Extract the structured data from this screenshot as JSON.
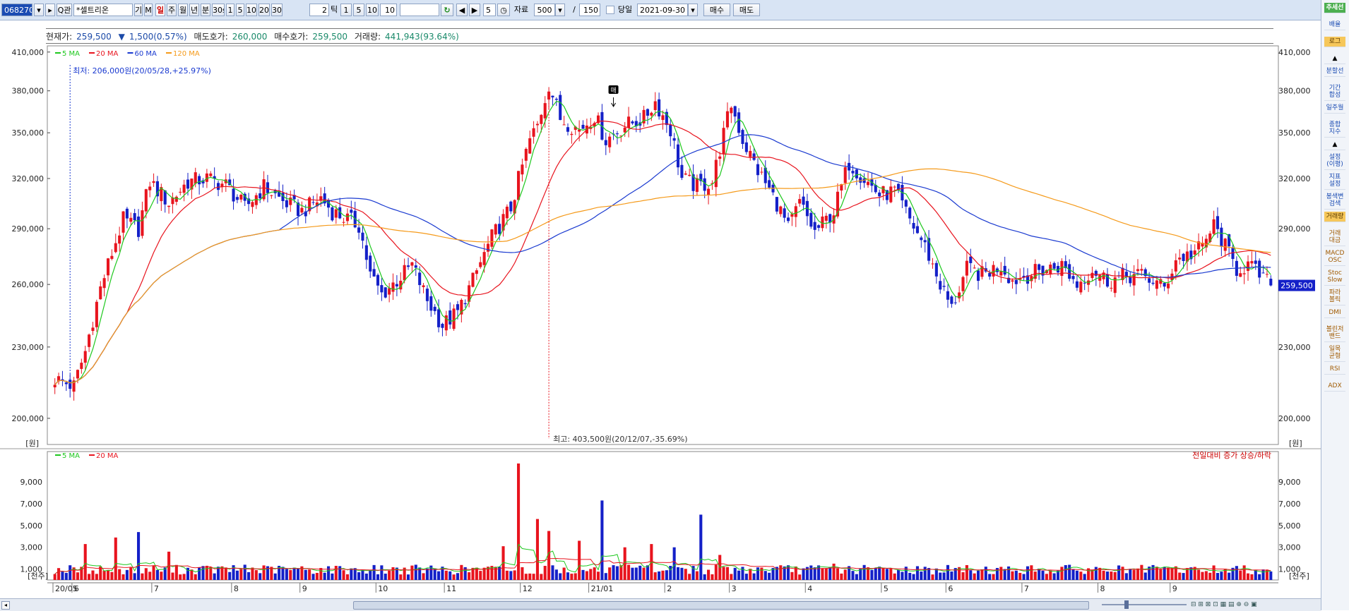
{
  "toolbar": {
    "code": "068270",
    "search_label": "Q",
    "search_badge": "관",
    "stock_name": "*셀트리온",
    "btn_gi": "기",
    "btn_m": "M",
    "periods": [
      "일",
      "주",
      "월",
      "년",
      "분",
      "30s",
      "1",
      "5",
      "10",
      "20",
      "30"
    ],
    "tick_value": "2",
    "tick_label": "틱",
    "tick_opts": [
      "1",
      "5",
      "10"
    ],
    "tick_count": "10",
    "step_value": "5",
    "data_label": "자료",
    "data_count": "500",
    "slash": "/",
    "view_count": "150",
    "today_label": "당일",
    "date": "2021-09-30",
    "buy_label": "매수",
    "sell_label": "매도"
  },
  "info": {
    "price_label": "현재가:",
    "price": "259,500",
    "change_arrow": "▼",
    "change": "1,500(0.57%)",
    "ask_label": "매도호가:",
    "ask": "260,000",
    "bid_label": "매수호가:",
    "bid": "259,500",
    "vol_label": "거래량:",
    "vol": "441,943(93.64%)"
  },
  "sidebar": {
    "items": [
      "추세선",
      "배율",
      "로그",
      "▲",
      "분할선",
      "기간\n합성",
      "일주월",
      "종합\n지수",
      "▲",
      "설정\n(이평)",
      "지표\n설정",
      "봉색변\n검색",
      "거래량",
      "거래\n대금",
      "MACD\nOSC",
      "Stoc\nSlow",
      "파라\n볼릭",
      "DMI",
      "볼린저\n밴드",
      "일목\n균형",
      "RSI",
      "ADX"
    ]
  },
  "colors": {
    "up": "#e8141e",
    "down": "#1420c8",
    "ma5": "#1ec81e",
    "ma20": "#e8141e",
    "ma60": "#1a3ad0",
    "ma120": "#f59a1a",
    "axis": "#444444",
    "grid": "#cccccc",
    "lowline": "#1a3ad0",
    "highline": "#e8141e",
    "label": "#1a3ad0"
  },
  "chart_data": [
    {
      "type": "candlestick",
      "title": "",
      "legend": [
        "5 MA",
        "20 MA",
        "60 MA",
        "120 MA"
      ],
      "unit": "[원]",
      "y_ticks": [
        "410,000",
        "380,000",
        "350,000",
        "320,000",
        "290,000",
        "260,000",
        "230,000",
        "200,000"
      ],
      "ylim": [
        190000,
        415000
      ],
      "log_scale": true,
      "x_labels": [
        "20/05",
        "6",
        "7",
        "8",
        "9",
        "10",
        "11",
        "12",
        "21/01",
        "2",
        "3",
        "4",
        "5",
        "6",
        "7",
        "8",
        "9"
      ],
      "x_label_index": [
        0,
        5,
        26,
        47,
        65,
        85,
        103,
        123,
        141,
        161,
        178,
        198,
        218,
        235,
        255,
        275,
        294
      ],
      "n_bars": 310,
      "current_price": "259,500",
      "low_annotation": "최저: 206,000원(20/05/28,+25.97%)",
      "high_annotation": "최고: 403,500원(20/12/07,-35.69%)",
      "marker_label": "매",
      "anchors": [
        [
          0,
          216000
        ],
        [
          5,
          213000
        ],
        [
          8,
          228000
        ],
        [
          12,
          258000
        ],
        [
          18,
          295000
        ],
        [
          22,
          290000
        ],
        [
          25,
          318000
        ],
        [
          30,
          305000
        ],
        [
          35,
          318000
        ],
        [
          40,
          320000
        ],
        [
          45,
          316000
        ],
        [
          50,
          302000
        ],
        [
          55,
          315000
        ],
        [
          60,
          306000
        ],
        [
          65,
          300000
        ],
        [
          70,
          308000
        ],
        [
          73,
          300000
        ],
        [
          80,
          292000
        ],
        [
          83,
          265000
        ],
        [
          86,
          255000
        ],
        [
          90,
          262000
        ],
        [
          94,
          270000
        ],
        [
          98,
          252000
        ],
        [
          102,
          240000
        ],
        [
          106,
          246000
        ],
        [
          110,
          262000
        ],
        [
          115,
          285000
        ],
        [
          120,
          302000
        ],
        [
          125,
          345000
        ],
        [
          127,
          355000
        ],
        [
          130,
          385000
        ],
        [
          133,
          360000
        ],
        [
          138,
          352000
        ],
        [
          142,
          362000
        ],
        [
          145,
          345000
        ],
        [
          150,
          355000
        ],
        [
          155,
          360000
        ],
        [
          158,
          372000
        ],
        [
          162,
          352000
        ],
        [
          165,
          320000
        ],
        [
          169,
          315000
        ],
        [
          173,
          318000
        ],
        [
          178,
          370000
        ],
        [
          181,
          345000
        ],
        [
          185,
          325000
        ],
        [
          190,
          305000
        ],
        [
          193,
          290000
        ],
        [
          196,
          305000
        ],
        [
          200,
          288000
        ],
        [
          205,
          300000
        ],
        [
          209,
          330000
        ],
        [
          213,
          320000
        ],
        [
          217,
          310000
        ],
        [
          221,
          312000
        ],
        [
          225,
          295000
        ],
        [
          229,
          280000
        ],
        [
          233,
          260000
        ],
        [
          236,
          248000
        ],
        [
          240,
          268000
        ],
        [
          244,
          265000
        ],
        [
          249,
          270000
        ],
        [
          252,
          262000
        ],
        [
          256,
          265000
        ],
        [
          261,
          268000
        ],
        [
          265,
          270000
        ],
        [
          269,
          260000
        ],
        [
          273,
          268000
        ],
        [
          277,
          262000
        ],
        [
          281,
          264000
        ],
        [
          285,
          265000
        ],
        [
          289,
          262000
        ],
        [
          292,
          258000
        ],
        [
          295,
          273000
        ],
        [
          299,
          276000
        ],
        [
          302,
          280000
        ],
        [
          305,
          292000
        ],
        [
          308,
          280000
        ],
        [
          311,
          268000
        ],
        [
          314,
          270000
        ],
        [
          317,
          265000
        ],
        [
          320,
          259500
        ]
      ]
    },
    {
      "type": "bar",
      "title": "",
      "legend": [
        "5 MA",
        "20 MA"
      ],
      "note": "전일대비 증가 상승/하락",
      "unit": "[천주]",
      "y_ticks": [
        "9,000",
        "7,000",
        "5,000",
        "3,000",
        "1,000"
      ],
      "ylim": [
        0,
        10500
      ],
      "spikes": [
        [
          8,
          3300
        ],
        [
          16,
          3900
        ],
        [
          22,
          4400
        ],
        [
          30,
          2600
        ],
        [
          50,
          1400
        ],
        [
          70,
          1100
        ],
        [
          118,
          3100
        ],
        [
          122,
          10700
        ],
        [
          127,
          5600
        ],
        [
          130,
          4500
        ],
        [
          138,
          3600
        ],
        [
          144,
          7300
        ],
        [
          150,
          3000
        ],
        [
          157,
          3300
        ],
        [
          163,
          3000
        ],
        [
          170,
          6000
        ],
        [
          175,
          2300
        ],
        [
          190,
          1200
        ],
        [
          205,
          1500
        ],
        [
          230,
          1100
        ],
        [
          250,
          1000
        ],
        [
          285,
          1050
        ],
        [
          300,
          1200
        ]
      ]
    }
  ]
}
